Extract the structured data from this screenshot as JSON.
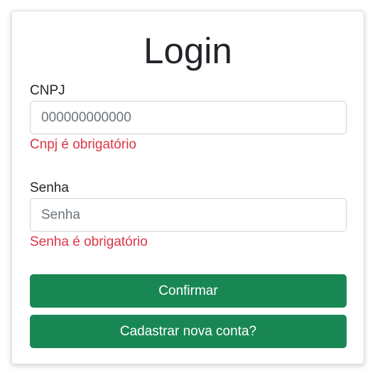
{
  "login": {
    "title": "Login",
    "cnpj": {
      "label": "CNPJ",
      "value": "",
      "placeholder": "000000000000",
      "error": "Cnpj é obrigatório"
    },
    "senha": {
      "label": "Senha",
      "value": "",
      "placeholder": "Senha",
      "error": "Senha é obrigatório"
    },
    "confirm_label": "Confirmar",
    "register_label": "Cadastrar nova conta?"
  },
  "colors": {
    "primary_button": "#198754",
    "error_text": "#dc3545",
    "input_border": "#ced4da"
  }
}
